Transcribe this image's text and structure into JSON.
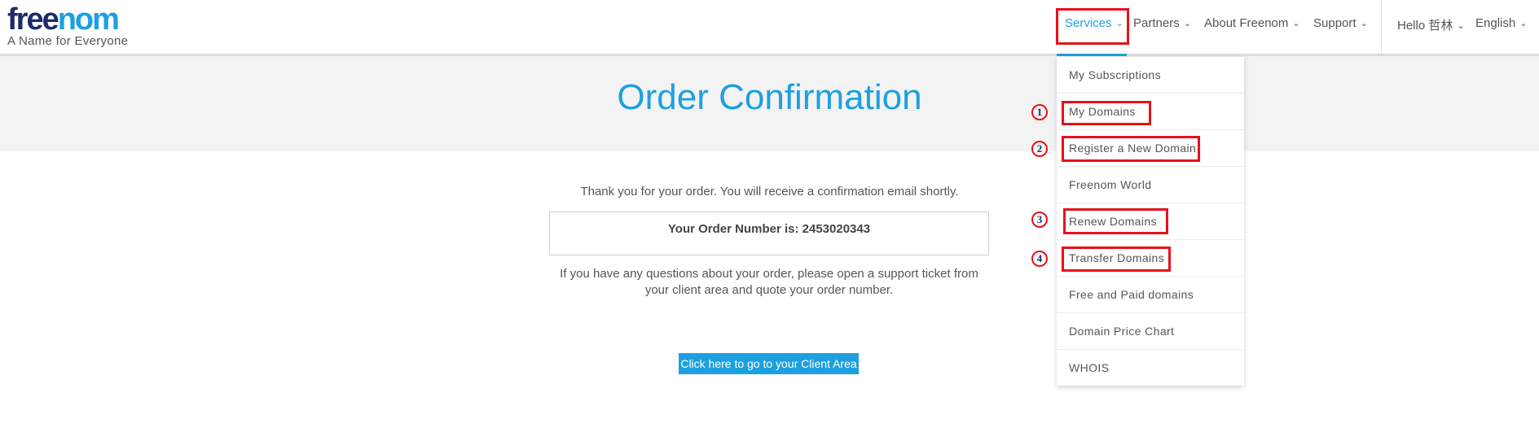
{
  "logo": {
    "word_part1": "free",
    "word_part2": "nom",
    "tagline": "A Name for Everyone"
  },
  "nav": {
    "services": "Services",
    "partners": "Partners",
    "about": "About Freenom",
    "support": "Support",
    "hello": "Hello 哲林",
    "language": "English",
    "chevron": "⌄"
  },
  "page": {
    "title": "Order Confirmation",
    "thanks": "Thank you for your order. You will receive a confirmation email shortly.",
    "order_number_text": "Your Order Number is: 2453020343",
    "questions": "If you have any questions about your order, please open a support ticket from your client area and quote your order number.",
    "client_button": "Click here to go to your Client Area"
  },
  "dropdown": {
    "items": [
      {
        "label": "My Subscriptions"
      },
      {
        "label": "My Domains"
      },
      {
        "label": "Register a New Domain"
      },
      {
        "label": "Freenom World"
      },
      {
        "label": "Renew Domains"
      },
      {
        "label": "Transfer Domains"
      },
      {
        "label": "Free and Paid domains"
      },
      {
        "label": "Domain Price Chart"
      },
      {
        "label": "WHOIS"
      }
    ]
  },
  "annotations": {
    "markers": [
      "1",
      "2",
      "3",
      "4"
    ]
  },
  "colors": {
    "accent": "#1da0e0",
    "highlight": "#e8101a",
    "logo_dark": "#1d2b6b"
  }
}
